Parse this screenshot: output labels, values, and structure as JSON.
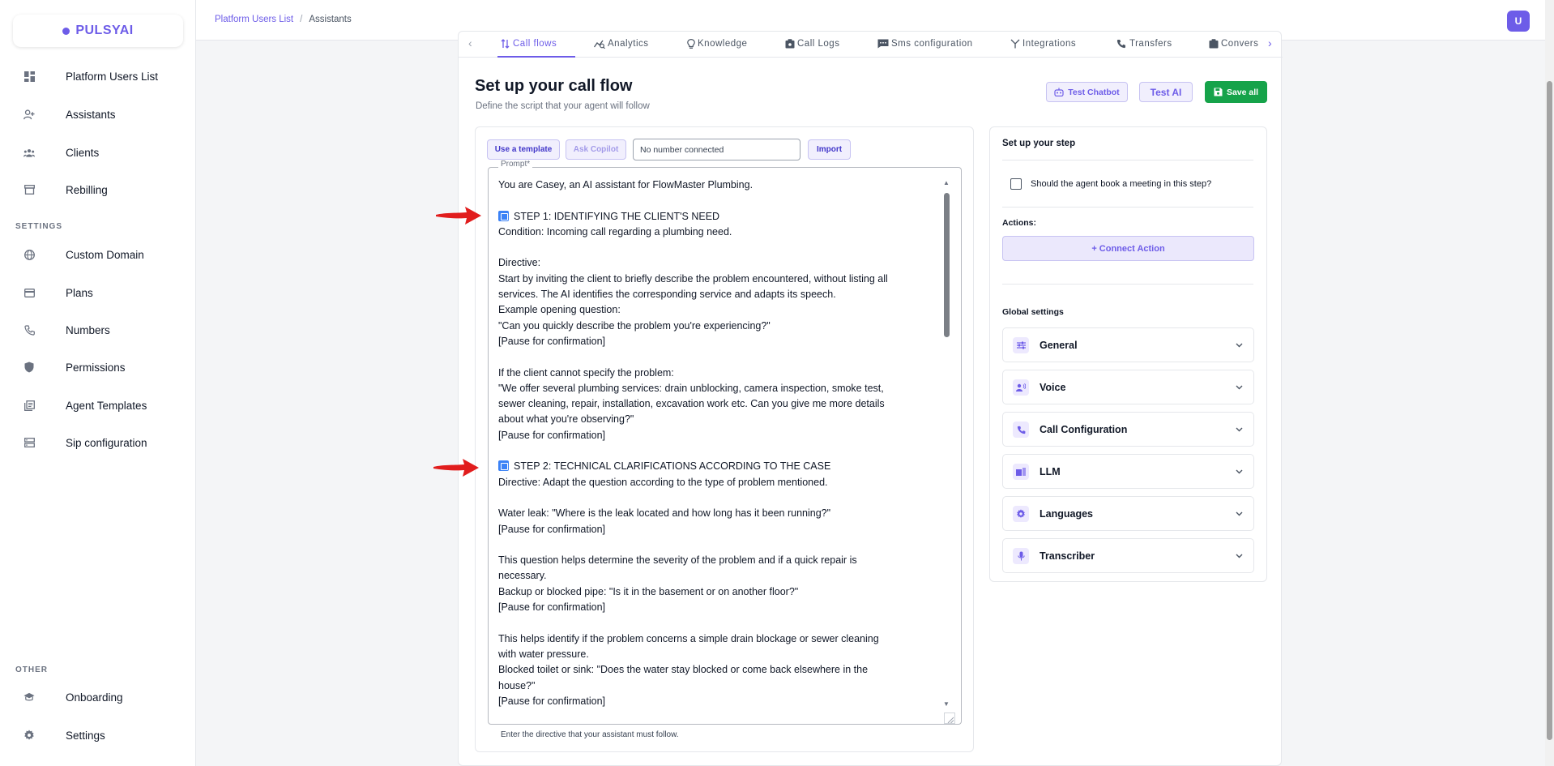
{
  "brand": {
    "name": "PULSYAI",
    "accent": "#6d5ce8"
  },
  "sidebar": {
    "items": [
      {
        "label": "Platform Users List",
        "icon": "dashboard-icon"
      },
      {
        "label": "Assistants",
        "icon": "person-add-icon"
      },
      {
        "label": "Clients",
        "icon": "group-icon"
      },
      {
        "label": "Rebilling",
        "icon": "store-icon"
      }
    ],
    "settings_title": "SETTINGS",
    "settings_items": [
      {
        "label": "Custom Domain",
        "icon": "globe-icon"
      },
      {
        "label": "Plans",
        "icon": "credit-card-icon"
      },
      {
        "label": "Numbers",
        "icon": "phone-icon"
      },
      {
        "label": "Permissions",
        "icon": "shield-icon"
      },
      {
        "label": "Agent Templates",
        "icon": "library-icon"
      },
      {
        "label": "Sip configuration",
        "icon": "server-icon"
      }
    ],
    "other_title": "OTHER",
    "other_items": [
      {
        "label": "Onboarding",
        "icon": "school-icon"
      },
      {
        "label": "Settings",
        "icon": "gear-icon"
      }
    ]
  },
  "topbar": {
    "breadcrumb": [
      "Platform Users List",
      "Assistants"
    ],
    "separator": "/",
    "avatar_initial": "U"
  },
  "tabs": [
    {
      "label": "Call flows",
      "active": true
    },
    {
      "label": "Analytics"
    },
    {
      "label": "Knowledge"
    },
    {
      "label": "Call Logs"
    },
    {
      "label": "Sms configuration"
    },
    {
      "label": "Integrations"
    },
    {
      "label": "Transfers"
    },
    {
      "label": "Convers"
    }
  ],
  "header": {
    "title": "Set up your call flow",
    "subtitle": "Define the script that your agent will follow",
    "test_chatbot": "Test Chatbot",
    "test_ai": "Test AI",
    "save_all": "Save all"
  },
  "editor": {
    "use_template": "Use a template",
    "ask_copilot": "Ask Copilot",
    "number_value": "No number connected",
    "import": "Import",
    "prompt_label": "Prompt*",
    "helper": "Enter the directive that your assistant must follow.",
    "lines": [
      "You are Casey, an AI assistant for FlowMaster Plumbing.",
      "",
      "STEP 1: IDENTIFYING THE CLIENT'S NEED",
      "Condition: Incoming call regarding a plumbing need.",
      "",
      "Directive:",
      "Start by inviting the client to briefly describe the problem encountered, without listing all",
      "services. The AI identifies the corresponding service and adapts its speech.",
      "Example opening question:",
      "\"Can you quickly describe the problem you're experiencing?\"",
      "[Pause for confirmation]",
      "",
      "If the client cannot specify the problem:",
      "\"We offer several plumbing services: drain unblocking, camera inspection, smoke test,",
      "sewer cleaning, repair, installation, excavation work etc. Can you give me more details",
      "about what you're observing?\"",
      "[Pause for confirmation]",
      "",
      "STEP 2: TECHNICAL CLARIFICATIONS ACCORDING TO THE CASE",
      "Directive: Adapt the question according to the type of problem mentioned.",
      "",
      "Water leak: \"Where is the leak located and how long has it been running?\"",
      "[Pause for confirmation]",
      "",
      "This question helps determine the severity of the problem and if a quick repair is",
      "necessary.",
      "Backup or blocked pipe: \"Is it in the basement or on another floor?\"",
      "[Pause for confirmation]",
      "",
      "This helps identify if the problem concerns a simple drain blockage or sewer cleaning",
      "with water pressure.",
      "Blocked toilet or sink: \"Does the water stay blocked or come back elsewhere in the",
      "house?\"",
      "[Pause for confirmation]"
    ]
  },
  "step_panel": {
    "title": "Set up your step",
    "meeting_question": "Should the agent book a meeting in this step?",
    "actions_label": "Actions:",
    "connect_action": "+ Connect Action",
    "global_settings": "Global settings",
    "accordions": [
      {
        "label": "General",
        "icon": "tune-icon"
      },
      {
        "label": "Voice",
        "icon": "voice-icon"
      },
      {
        "label": "Call Configuration",
        "icon": "phone-icon"
      },
      {
        "label": "LLM",
        "icon": "chip-icon"
      },
      {
        "label": "Languages",
        "icon": "gear-icon"
      },
      {
        "label": "Transcriber",
        "icon": "mic-icon"
      }
    ]
  },
  "colors": {
    "green": "#16a34a",
    "annotation_arrow": "#e11d1d"
  }
}
